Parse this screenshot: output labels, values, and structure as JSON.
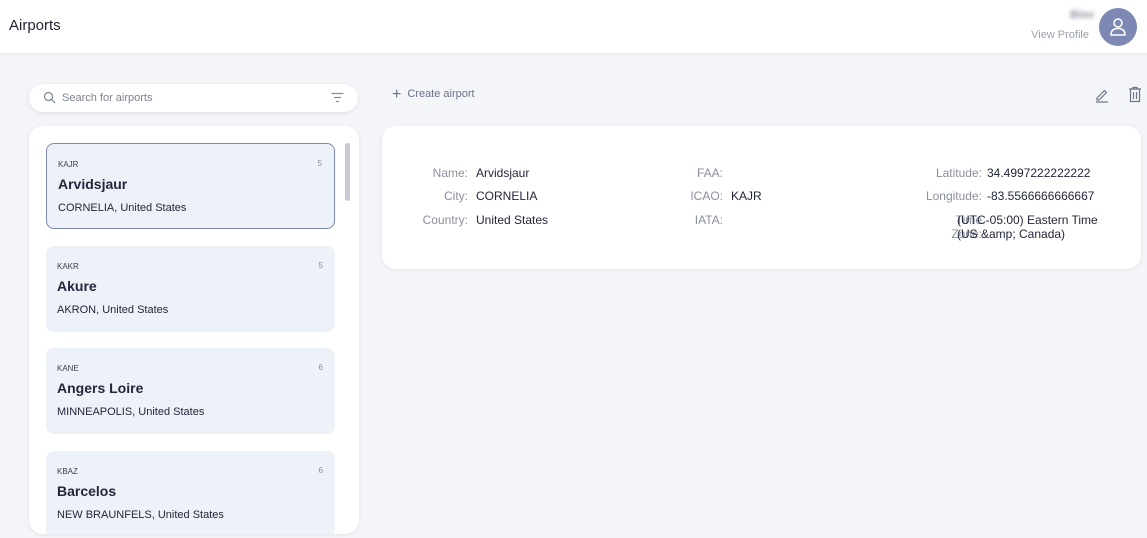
{
  "header": {
    "title": "Airports",
    "profile_name": "Biso",
    "profile_link": "View Profile"
  },
  "search": {
    "placeholder": "Search for airports",
    "value": ""
  },
  "toolbar": {
    "create_label": "Create airport"
  },
  "airports": [
    {
      "code": "KAJR",
      "count": "5",
      "name": "Arvidsjaur",
      "location": "CORNELIA, United States",
      "selected": true
    },
    {
      "code": "KAKR",
      "count": "5",
      "name": "Akure",
      "location": "AKRON, United States",
      "selected": false
    },
    {
      "code": "KANE",
      "count": "6",
      "name": "Angers Loire",
      "location": "MINNEAPOLIS, United States",
      "selected": false
    },
    {
      "code": "KBAZ",
      "count": "6",
      "name": "Barcelos",
      "location": "NEW BRAUNFELS, United States",
      "selected": false
    }
  ],
  "detail": {
    "name_label": "Name:",
    "name": "Arvidsjaur",
    "city_label": "City:",
    "city": "CORNELIA",
    "country_label": "Country:",
    "country": "United States",
    "faa_label": "FAA:",
    "faa": "",
    "icao_label": "ICAO:",
    "icao": "KAJR",
    "iata_label": "IATA:",
    "iata": "",
    "latitude_label": "Latitude:",
    "latitude": "34.4997222222222",
    "longitude_label": "Longitude:",
    "longitude": "-83.5566666666667",
    "timezone_label_1": "Time",
    "timezone_label_2": "Zone:",
    "timezone_1": "(UTC-05:00) Eastern Time",
    "timezone_2": "(US &amp; Canada)"
  },
  "colors": {
    "accent": "#7d88b3",
    "card_bg": "#edf1f8",
    "page_bg": "#f4f5f8"
  },
  "icons": [
    "search-icon",
    "filter-icon",
    "plus-icon",
    "edit-icon",
    "trash-icon",
    "user-icon"
  ]
}
